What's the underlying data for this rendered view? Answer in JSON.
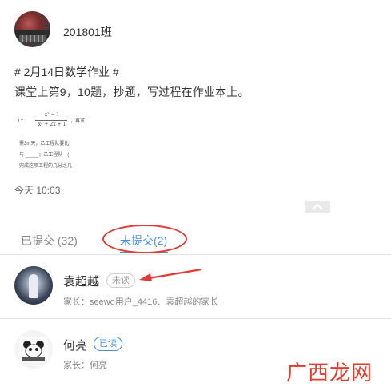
{
  "header": {
    "class_name": "201801班"
  },
  "post": {
    "title": "# 2月14日数学作业 #",
    "body": "课堂上第9，10题，抄题，写过程在作业本上。",
    "attachment": {
      "line1": "x² − 1",
      "line2": "x² + 2x + 1",
      "line3": "，再求",
      "line4": "需3m天，乙工程队要比",
      "line5": "与 _____；乙工程队一(",
      "line6": "完成这项工程的几分之几"
    },
    "time": "今天 10:03"
  },
  "tabs": {
    "submitted": "已提交 (32)",
    "unsubmitted": "未提交(2)"
  },
  "students": [
    {
      "name": "袁超越",
      "status": "未读",
      "parents": "家长：seewo用户_4416、袁超越的家长"
    },
    {
      "name": "何亮",
      "status": "已读",
      "parents": "家长：何亮"
    }
  ],
  "watermark": "广西龙网",
  "colors": {
    "accent": "#4a90d9",
    "annotation": "#e53935"
  }
}
